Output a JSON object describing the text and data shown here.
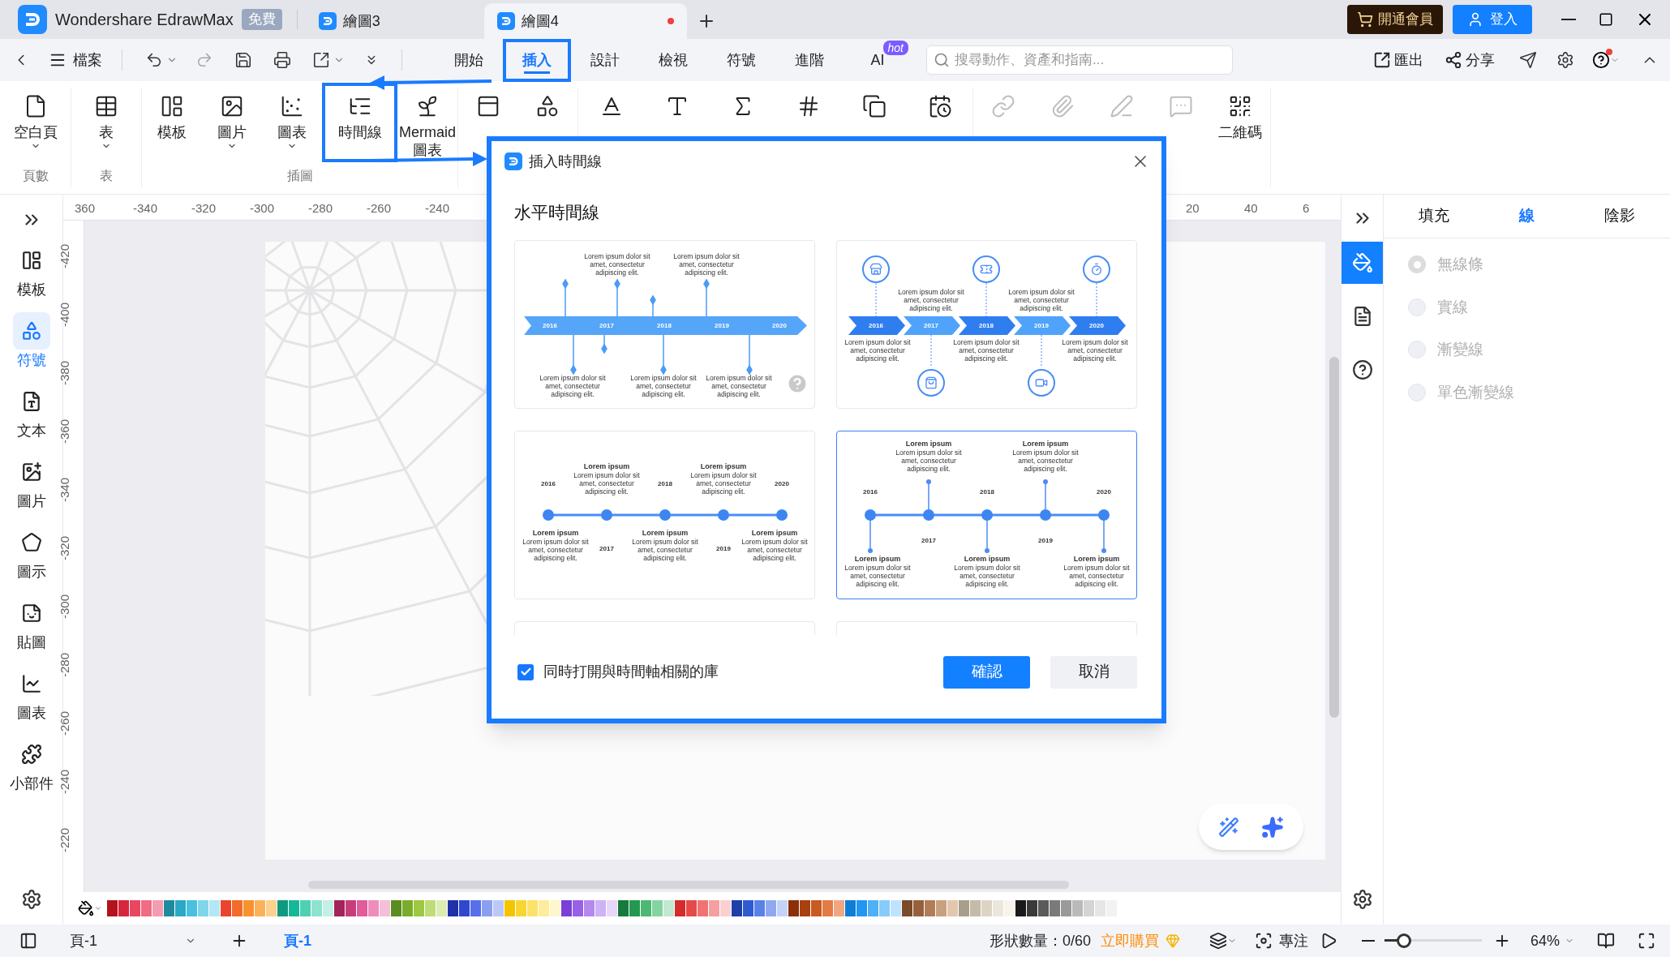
{
  "title_bar": {
    "app_name": "Wondershare EdrawMax",
    "plan_badge": "免費",
    "tabs": [
      {
        "label": "繪圖3",
        "selected": false,
        "unsaved": false
      },
      {
        "label": "繪圖4",
        "selected": true,
        "unsaved": true
      }
    ],
    "member_button": "開通會員",
    "login_button": "登入"
  },
  "toolbar": {
    "file_menu": "檔案",
    "tabs": [
      {
        "label": "開始",
        "selected": false,
        "callout": false
      },
      {
        "label": "插入",
        "selected": true,
        "callout": true
      },
      {
        "label": "設計",
        "selected": false,
        "callout": false
      },
      {
        "label": "檢視",
        "selected": false,
        "callout": false
      },
      {
        "label": "符號",
        "selected": false,
        "callout": false
      },
      {
        "label": "進階",
        "selected": false,
        "callout": false
      },
      {
        "label": "AI",
        "selected": false,
        "callout": false,
        "badge": "hot"
      }
    ],
    "search": {
      "placeholder": "搜尋動作、資產和指南..."
    },
    "export": "匯出",
    "share": "分享"
  },
  "ribbon": {
    "groups": [
      {
        "label": "頁數",
        "items": [
          {
            "label": "空白頁",
            "dropdown": true,
            "disabled": false,
            "callout": false
          }
        ]
      },
      {
        "label": "表",
        "items": [
          {
            "label": "表",
            "dropdown": true,
            "disabled": false,
            "callout": false
          }
        ]
      },
      {
        "label": "插圖",
        "items": [
          {
            "label": "模板",
            "dropdown": false,
            "disabled": false,
            "callout": false
          },
          {
            "label": "圖片",
            "dropdown": true,
            "disabled": false,
            "callout": false
          },
          {
            "label": "圖表",
            "dropdown": true,
            "disabled": false,
            "callout": false
          },
          {
            "label": "時間線",
            "dropdown": false,
            "disabled": false,
            "callout": true
          },
          {
            "label": "Mermaid 圖表",
            "dropdown": false,
            "disabled": false,
            "callout": false
          }
        ]
      },
      {
        "items": [
          {
            "dropdown": false,
            "disabled": false,
            "callout": false
          },
          {
            "dropdown": false,
            "disabled": false,
            "callout": false
          }
        ]
      },
      {
        "items": [
          {
            "dropdown": false,
            "disabled": false,
            "callout": false
          },
          {
            "dropdown": false,
            "disabled": false,
            "callout": false
          },
          {
            "dropdown": false,
            "disabled": false,
            "callout": false
          },
          {
            "dropdown": false,
            "disabled": false,
            "callout": false
          },
          {
            "dropdown": false,
            "disabled": false,
            "callout": false
          },
          {
            "dropdown": false,
            "disabled": false,
            "callout": false
          }
        ]
      },
      {
        "items": [
          {
            "dropdown": false,
            "disabled": true,
            "callout": false
          },
          {
            "dropdown": false,
            "disabled": true,
            "callout": false
          },
          {
            "dropdown": false,
            "disabled": true,
            "callout": false
          },
          {
            "dropdown": false,
            "disabled": true,
            "callout": false
          },
          {
            "label": "二維碼",
            "dropdown": false,
            "disabled": false,
            "callout": false
          }
        ]
      }
    ]
  },
  "left_sidebar": {
    "items": [
      {
        "label": "模板",
        "selected": false
      },
      {
        "label": "符號",
        "selected": true
      },
      {
        "label": "文本",
        "selected": false
      },
      {
        "label": "圖片",
        "selected": false
      },
      {
        "label": "圖示",
        "selected": false
      },
      {
        "label": "貼圖",
        "selected": false
      },
      {
        "label": "圖表",
        "selected": false
      },
      {
        "label": "小部件",
        "selected": false
      }
    ]
  },
  "canvas": {
    "top_ruler": [
      "360",
      "-340",
      "-320",
      "-300",
      "-280",
      "-260",
      "-240",
      "20",
      "40",
      "6"
    ],
    "left_ruler": [
      "-420",
      "-400",
      "-380",
      "-360",
      "-340",
      "-320",
      "-300",
      "-280",
      "-260",
      "-240",
      "-220"
    ]
  },
  "dialog": {
    "title": "插入時間線",
    "section": "水平時間線",
    "templates": [
      {
        "kind": "arrow",
        "selected": false,
        "years": [
          "2016",
          "2017",
          "2018",
          "2019",
          "2020"
        ],
        "notes": [
          {
            "text": "Lorem ipsum dolor sit amet, consectetur adipiscing elit."
          },
          {
            "text": "Lorem ipsum dolor sit amet, consectetur adipiscing elit."
          },
          {
            "text": "Lorem ipsum dolor sit amet, consectetur adipiscing elit."
          },
          {
            "text": "Lorem ipsum dolor sit amet, consectetur adipiscing elit."
          },
          {
            "text": "Lorem ipsum dolor sit amet, consectetur adipiscing elit."
          }
        ]
      },
      {
        "kind": "chevron",
        "selected": false,
        "years": [
          "2016",
          "2017",
          "2018",
          "2019",
          "2020"
        ],
        "notes": [
          {
            "text": "Lorem ipsum dolor sit amet, consectetur adipiscing elit."
          },
          {
            "text": "Lorem ipsum dolor sit amet, consectetur adipiscing elit."
          },
          {
            "text": "Lorem ipsum dolor sit amet, consectetur adipiscing elit."
          },
          {
            "text": "Lorem ipsum dolor sit amet, consectetur adipiscing elit."
          },
          {
            "text": "Lorem ipsum dolor sit amet, consectetur adipiscing elit."
          }
        ]
      },
      {
        "kind": "dots",
        "selected": false,
        "years": [
          "2016",
          "2017",
          "2018",
          "2019",
          "2020"
        ],
        "notes": [
          {
            "title": "Lorem ipsum",
            "text": "Lorem ipsum dolor sit amet, consectetur adipiscing elit."
          },
          {
            "title": "Lorem ipsum",
            "text": "Lorem ipsum dolor sit amet, consectetur adipiscing elit."
          },
          {
            "title": "Lorem ipsum",
            "text": "Lorem ipsum dolor sit amet, consectetur adipiscing elit."
          },
          {
            "title": "Lorem ipsum",
            "text": "Lorem ipsum dolor sit amet, consectetur adipiscing elit."
          },
          {
            "title": "Lorem ipsum",
            "text": "Lorem ipsum dolor sit amet, consectetur adipiscing elit."
          }
        ]
      },
      {
        "kind": "stems",
        "selected": true,
        "years": [
          "2016",
          "2017",
          "2018",
          "2019",
          "2020"
        ],
        "notes": [
          {
            "title": "Lorem ipsum",
            "text": "Lorem ipsum dolor sit amet, consectetur adipiscing elit."
          },
          {
            "title": "Lorem ipsum",
            "text": "Lorem ipsum dolor sit amet, consectetur adipiscing elit."
          },
          {
            "title": "Lorem ipsum",
            "text": "Lorem ipsum dolor sit amet, consectetur adipiscing elit."
          },
          {
            "title": "Lorem ipsum",
            "text": "Lorem ipsum dolor sit amet, consectetur adipiscing elit."
          },
          {
            "title": "Lorem ipsum",
            "text": "Lorem ipsum dolor sit amet, consectetur adipiscing elit."
          }
        ]
      },
      {
        "kind": "partial",
        "selected": false
      },
      {
        "kind": "partial",
        "selected": false
      }
    ],
    "library_checkbox": {
      "label": "同時打開與時間軸相關的庫",
      "checked": true
    },
    "confirm": "確認",
    "cancel": "取消"
  },
  "right_panel": {
    "tools": [
      {
        "selected": true
      },
      {
        "selected": false
      },
      {
        "selected": false
      }
    ],
    "tabs": [
      {
        "label": "填充",
        "selected": false
      },
      {
        "label": "線",
        "selected": true
      },
      {
        "label": "陰影",
        "selected": false
      }
    ],
    "options": [
      {
        "label": "無線條",
        "selected": true,
        "disabled": true
      },
      {
        "label": "實線",
        "selected": false,
        "disabled": true
      },
      {
        "label": "漸變線",
        "selected": false,
        "disabled": true
      },
      {
        "label": "單色漸變線",
        "selected": false,
        "disabled": true
      }
    ]
  },
  "status_bar": {
    "page_selector": "頁-1",
    "page_tab": "頁-1",
    "shape_count": "形狀數量：0/60",
    "buy_link": "立即購買",
    "focus": "專注",
    "zoom_slider": {
      "level": 0.2
    },
    "zoom": "64%"
  }
}
